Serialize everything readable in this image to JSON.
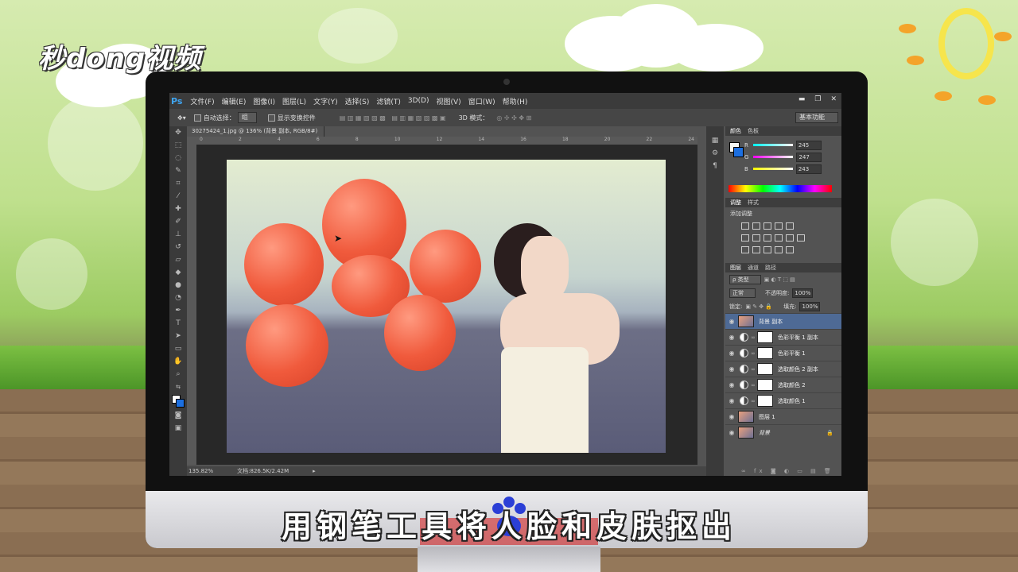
{
  "brand": {
    "logo_text": "秒dong视频"
  },
  "subtitle": "用钢笔工具将人脸和皮肤抠出",
  "photoshop": {
    "app_icon": "Ps",
    "menu": [
      "文件(F)",
      "编辑(E)",
      "图像(I)",
      "图层(L)",
      "文字(Y)",
      "选择(S)",
      "滤镜(T)",
      "3D(D)",
      "视图(V)",
      "窗口(W)",
      "帮助(H)"
    ],
    "window_controls": [
      "▬",
      "❐",
      "✕"
    ],
    "options": {
      "auto_select_label": "自动选择：",
      "auto_select_value": "组",
      "show_transform_label": "显示变换控件",
      "mode_3d_label": "3D 模式：",
      "workspace": "基本功能"
    },
    "document_tab": "30275424_1.jpg @ 136% (背景 副本, RGB/8#) *",
    "ruler_ticks": [
      "0",
      "2",
      "4",
      "6",
      "8",
      "10",
      "12",
      "14",
      "16",
      "18",
      "20",
      "22",
      "24"
    ],
    "status": {
      "zoom": "135.82%",
      "doc_info": "文档:826.5K/2.42M"
    },
    "color_panel": {
      "tabs": [
        "颜色",
        "色板"
      ],
      "channels": [
        {
          "label": "R",
          "value": "245",
          "color": "#e05050"
        },
        {
          "label": "G",
          "value": "247",
          "color": "#c040c0"
        },
        {
          "label": "B",
          "value": "243",
          "color": "#d0d030"
        }
      ],
      "foreground": "#f5f7f3",
      "background": "#1c6fe0"
    },
    "adjust_panel": {
      "tabs": [
        "调整",
        "样式"
      ],
      "title": "添加调整"
    },
    "layers_panel": {
      "tabs": [
        "图层",
        "通道",
        "路径"
      ],
      "filter_label": "ρ 类型",
      "blend_mode": "正常",
      "opacity_label": "不透明度:",
      "opacity_value": "100%",
      "lock_label": "锁定:",
      "fill_label": "填充:",
      "fill_value": "100%",
      "layers": [
        {
          "name": "背景 副本",
          "thumb": "photo",
          "adjustment": false,
          "selected": true
        },
        {
          "name": "色彩平衡 1 副本",
          "thumb": "white",
          "adjustment": true,
          "selected": false
        },
        {
          "name": "色彩平衡 1",
          "thumb": "white",
          "adjustment": true,
          "selected": false
        },
        {
          "name": "选取颜色 2 副本",
          "thumb": "white",
          "adjustment": true,
          "selected": false
        },
        {
          "name": "选取颜色 2",
          "thumb": "white",
          "adjustment": true,
          "selected": false
        },
        {
          "name": "选取颜色 1",
          "thumb": "white",
          "adjustment": true,
          "selected": false
        },
        {
          "name": "图层 1",
          "thumb": "photo",
          "adjustment": false,
          "selected": false
        },
        {
          "name": "背景",
          "thumb": "photo",
          "adjustment": false,
          "selected": false,
          "locked": true
        }
      ]
    }
  }
}
